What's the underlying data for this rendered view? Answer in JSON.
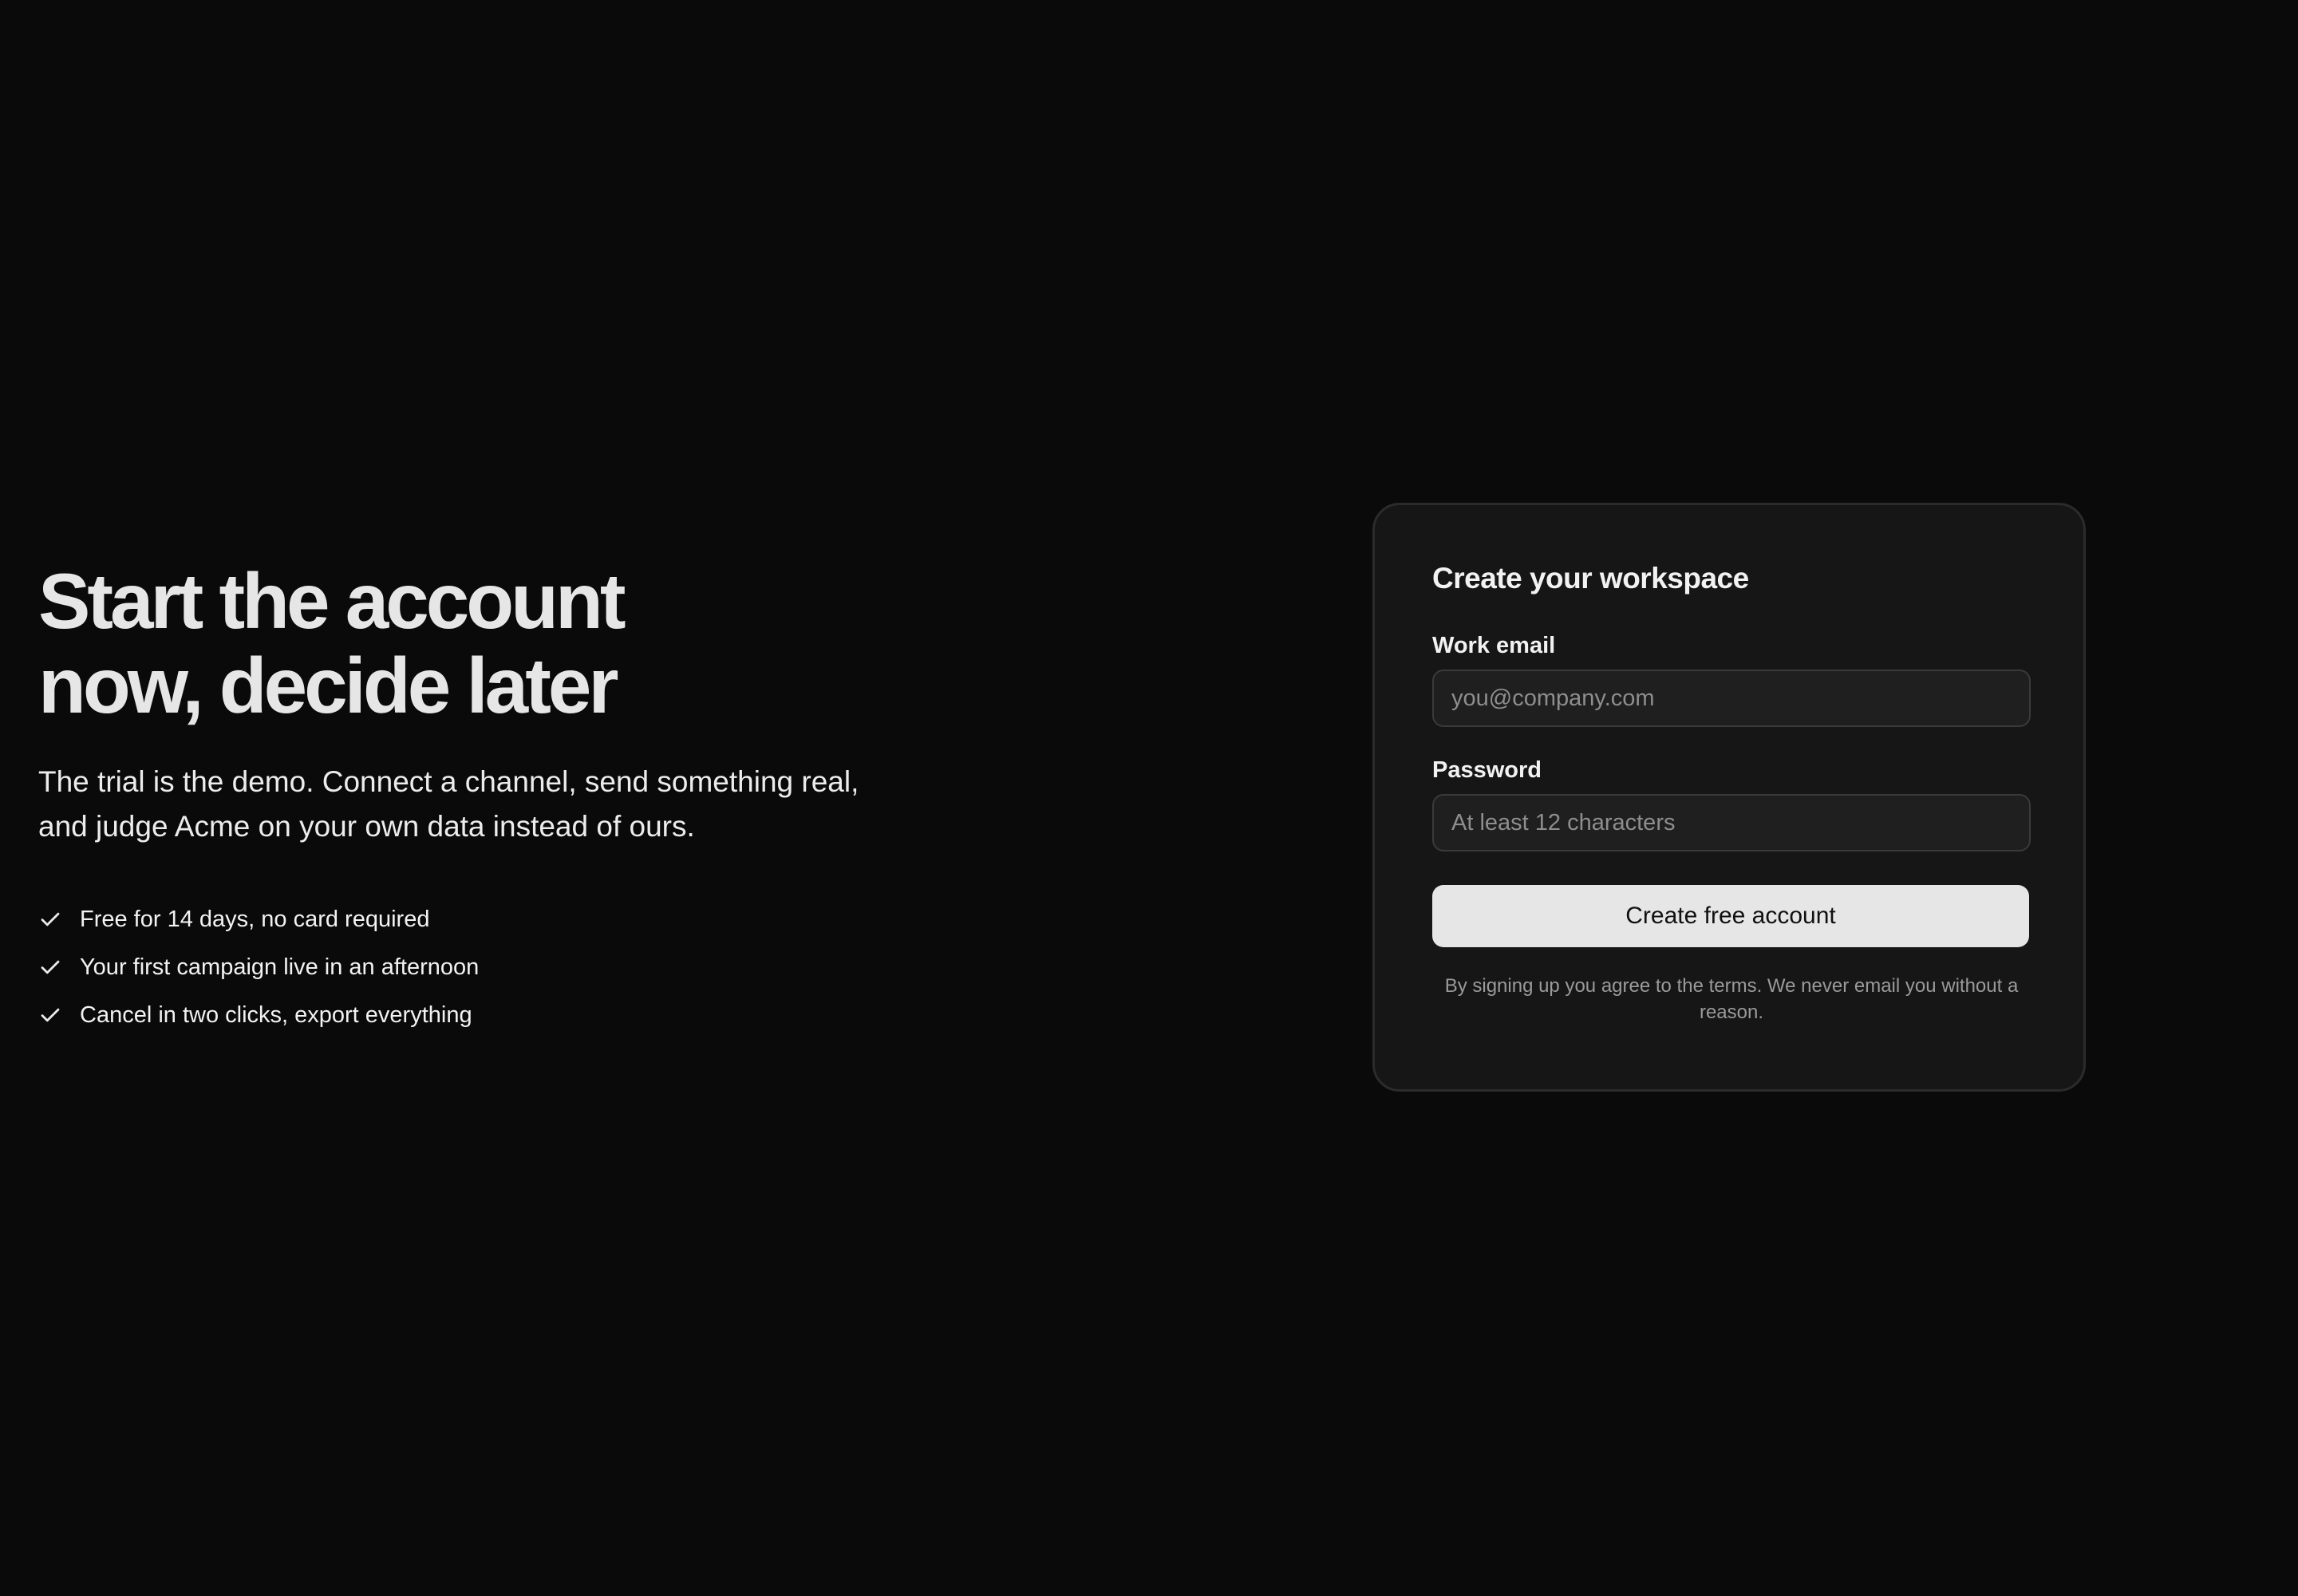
{
  "hero": {
    "title": "Start the account now, decide later",
    "subtitle": "The trial is the demo. Connect a channel, send something real, and judge Acme on your own data instead of ours.",
    "benefits": [
      {
        "icon": "check-icon",
        "text": "Free for 14 days, no card required"
      },
      {
        "icon": "check-icon",
        "text": "Your first campaign live in an afternoon"
      },
      {
        "icon": "check-icon",
        "text": "Cancel in two clicks, export everything"
      }
    ]
  },
  "signup": {
    "title": "Create your workspace",
    "email_label": "Work email",
    "email_placeholder": "you@company.com",
    "email_value": "",
    "password_label": "Password",
    "password_placeholder": "At least 12 characters",
    "password_value": "",
    "submit_label": "Create free account",
    "fine_print": "By signing up you agree to the terms. We never email you without a reason."
  },
  "colors": {
    "background": "#0a0a0a",
    "card": "#161616",
    "card_border": "#2b2b2b",
    "input_bg": "#1f1f1f",
    "button_bg": "#e6e6e6",
    "text": "#ececec",
    "muted": "#9a9a9a"
  }
}
